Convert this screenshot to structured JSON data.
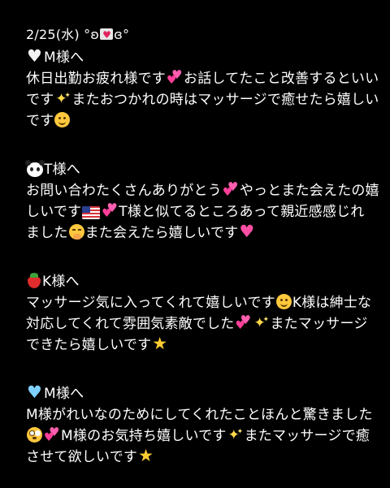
{
  "date_line": {
    "date": "2/25(水)",
    "kaomoji_left": "°ʚ",
    "kaomoji_right": "ɞ°"
  },
  "sections": [
    {
      "heading_icon": "white-heart",
      "heading": "M様へ",
      "lines": [
        "休日出勤お疲れ様です",
        "お話してたこと改善するといい",
        "です",
        "またおつかれの時はマッサージで癒せたら嬉しい",
        "です"
      ]
    },
    {
      "heading_icon": "panda",
      "heading": "T様へ",
      "lines": [
        "お問い合わたくさんありがとう",
        "やっとまた会えたの嬉",
        "しいです",
        "T様と似てるところあって親近感感じれ",
        "ました",
        "また会えたら嬉しいです"
      ]
    },
    {
      "heading_icon": "strawberry",
      "heading": "K様へ",
      "lines": [
        "マッサージ気に入ってくれて嬉しいです",
        "K様は紳士な",
        "対応してくれて雰囲気素敵でした",
        "またマッサージ",
        "できたら嬉しいです"
      ]
    },
    {
      "heading_icon": "blue-heart",
      "heading": "M様へ",
      "lines": [
        "M様がれいなのためにしてくれたことほんと驚きました",
        "M様のお気持ち嬉しいです",
        "またマッサージで癒",
        "させて欲しいです"
      ]
    }
  ],
  "colors": {
    "background": "#000000",
    "text": "#ffffff"
  }
}
